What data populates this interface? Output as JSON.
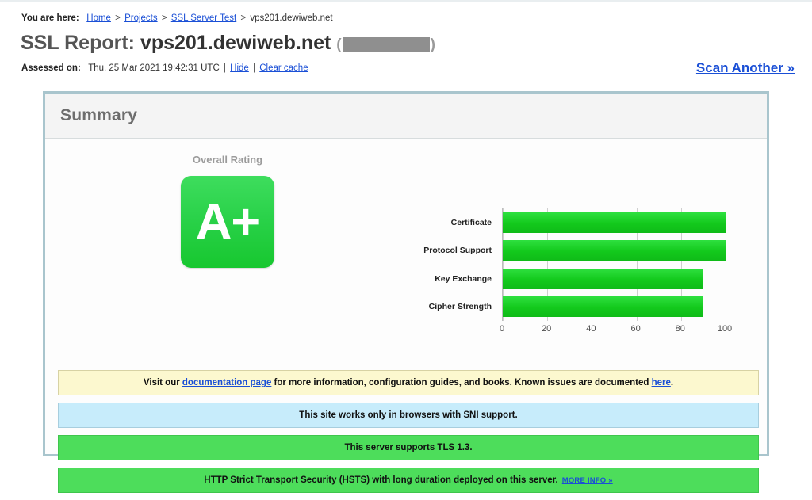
{
  "breadcrumb": {
    "prefix": "You are here:",
    "items": [
      {
        "label": "Home",
        "link": true
      },
      {
        "label": "Projects",
        "link": true
      },
      {
        "label": "SSL Server Test",
        "link": true
      },
      {
        "label": "vps201.dewiweb.net",
        "link": false
      }
    ],
    "separator": ">"
  },
  "header": {
    "title_prefix": "SSL Report:",
    "hostname": "vps201.dewiweb.net",
    "paren_open": "(",
    "paren_close": ")",
    "ip_redacted": true,
    "assessed_label": "Assessed on:",
    "assessed_value": "Thu, 25 Mar 2021 19:42:31 UTC",
    "hide_label": "Hide",
    "clear_cache_label": "Clear cache",
    "pipe": "|",
    "scan_another_label": "Scan Another »"
  },
  "summary": {
    "panel_title": "Summary",
    "overall_rating_caption": "Overall Rating",
    "grade": "A+",
    "grade_color": "#2ad24a"
  },
  "chart_data": {
    "type": "bar",
    "orientation": "horizontal",
    "title": "",
    "categories": [
      "Certificate",
      "Protocol Support",
      "Key Exchange",
      "Cipher Strength"
    ],
    "values": [
      100,
      100,
      90,
      90
    ],
    "xlabel": "",
    "ylabel": "",
    "xlim": [
      0,
      100
    ],
    "ticks": [
      0,
      20,
      40,
      60,
      80,
      100
    ],
    "tick_labels": [
      "0",
      "20",
      "40",
      "60",
      "80",
      "100"
    ],
    "grid": true,
    "legend": false,
    "bar_color": "#13c91c"
  },
  "notices": [
    {
      "id": "documentation-notice",
      "style": "yellow",
      "parts": [
        {
          "type": "text",
          "value": "Visit our "
        },
        {
          "type": "link",
          "value": "documentation page"
        },
        {
          "type": "text",
          "value": " for more information, configuration guides, and books. Known issues are documented "
        },
        {
          "type": "link",
          "value": "here"
        },
        {
          "type": "text",
          "value": "."
        }
      ]
    },
    {
      "id": "sni-notice",
      "style": "blue",
      "parts": [
        {
          "type": "text",
          "value": "This site works only in browsers with SNI support."
        }
      ]
    },
    {
      "id": "tls13-notice",
      "style": "green",
      "parts": [
        {
          "type": "text",
          "value": "This server supports TLS 1.3."
        }
      ]
    },
    {
      "id": "hsts-notice",
      "style": "green",
      "parts": [
        {
          "type": "text",
          "value": "HTTP Strict Transport Security (HSTS) with long duration deployed on this server."
        },
        {
          "type": "moreinfo",
          "value": "MORE INFO »"
        }
      ]
    }
  ],
  "colors": {
    "link": "#1a4fd6",
    "panel_border": "#a9c5cd",
    "grade_green": "#2ad24a",
    "notice_yellow": "#fcf8cf",
    "notice_blue": "#c7ecfb",
    "notice_green": "#4ddd5b"
  }
}
